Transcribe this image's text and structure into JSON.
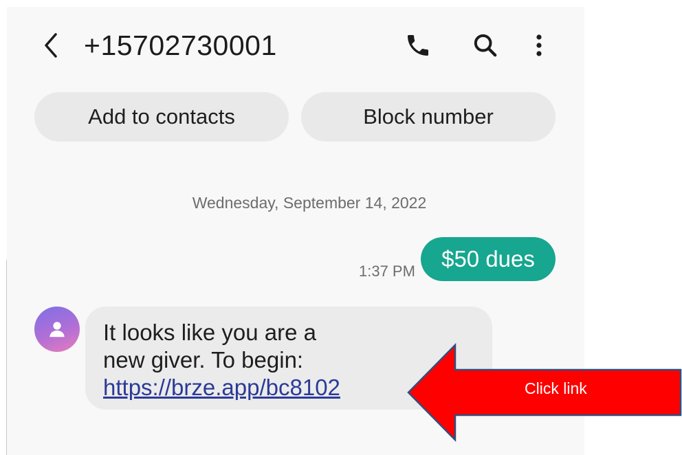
{
  "header": {
    "phone_number": "+15702730001",
    "back_icon": "chevron-left-icon",
    "call_icon": "phone-icon",
    "search_icon": "search-icon",
    "menu_icon": "more-vertical-icon"
  },
  "actions": {
    "add_contacts": "Add to contacts",
    "block_number": "Block number"
  },
  "conversation": {
    "date": "Wednesday, September 14, 2022",
    "sent_message": {
      "time": "1:37 PM",
      "text": "$50 dues",
      "color": "#17a68f"
    },
    "received_message": {
      "line1": "It looks like you are a",
      "line2": "new giver. To begin:",
      "link": "https://brze.app/bc8102",
      "avatar_icon": "person-icon"
    }
  },
  "annotation": {
    "label": "Click link",
    "color": "#ff0000",
    "border_color": "#2f4f7f"
  }
}
